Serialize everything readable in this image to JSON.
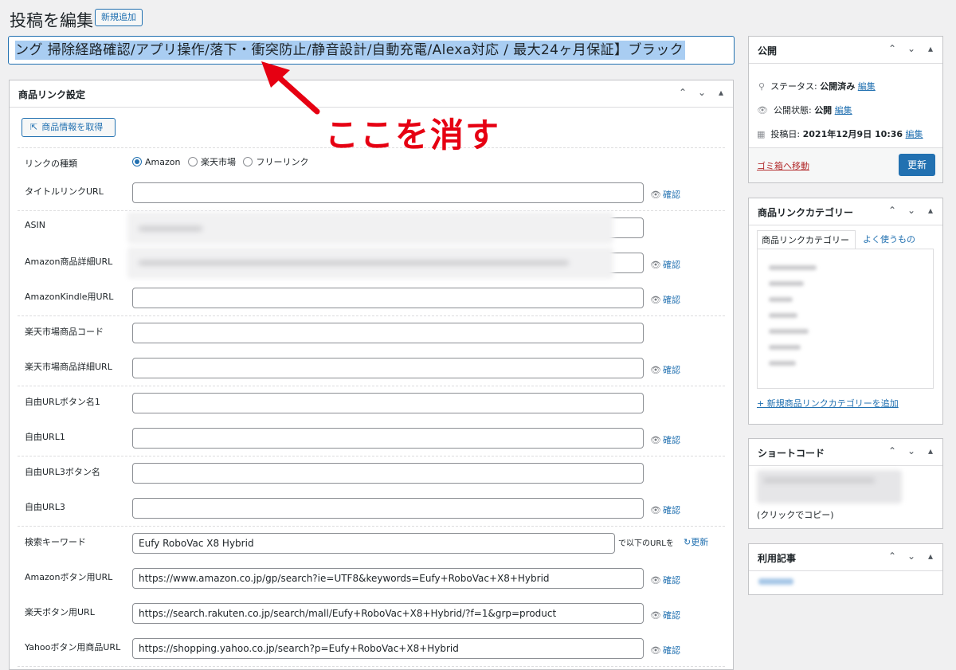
{
  "header": {
    "title": "投稿を編集",
    "add_new": "新規追加"
  },
  "post_title": "ング 掃除経路確認/アプリ操作/落下・衝突防止/静音設計/自動充電/Alexa対応 / 最大24ヶ月保証】ブラック",
  "annotation": {
    "text": "ここを消す",
    "color": "#e60012"
  },
  "metabox": {
    "title": "商品リンク設定",
    "get_info_button": "商品情報を取得",
    "link_type_label": "リンクの種類",
    "link_types": [
      "Amazon",
      "楽天市場",
      "フリーリンク"
    ],
    "check_label": "確認",
    "fields": {
      "title_url": {
        "label": "タイトルリンクURL",
        "value": ""
      },
      "asin": {
        "label": "ASIN"
      },
      "amazon_detail_url": {
        "label": "Amazon商品詳細URL"
      },
      "kindle_url": {
        "label": "AmazonKindle用URL",
        "value": ""
      },
      "rakuten_code": {
        "label": "楽天市場商品コード",
        "value": ""
      },
      "rakuten_detail_url": {
        "label": "楽天市場商品詳細URL",
        "value": ""
      },
      "free_btn1": {
        "label": "自由URLボタン名1",
        "value": ""
      },
      "free_url1": {
        "label": "自由URL1",
        "value": ""
      },
      "free_btn3": {
        "label": "自由URL3ボタン名",
        "value": ""
      },
      "free_url3": {
        "label": "自由URL3",
        "value": ""
      },
      "keyword": {
        "label": "検索キーワード",
        "value": "Eufy RoboVac X8 Hybrid",
        "suffix": "で以下のURLを",
        "refresh": "更新"
      },
      "amazon_btn_url": {
        "label": "Amazonボタン用URL",
        "value": "https://www.amazon.co.jp/gp/search?ie=UTF8&keywords=Eufy+RoboVac+X8+Hybrid"
      },
      "rakuten_btn_url": {
        "label": "楽天ボタン用URL",
        "value": "https://search.rakuten.co.jp/search/mall/Eufy+RoboVac+X8+Hybrid/?f=1&grp=product"
      },
      "yahoo_btn_url": {
        "label": "Yahooボタン用商品URL",
        "value": "https://shopping.yahoo.co.jp/search?p=Eufy+RoboVac+X8+Hybrid"
      }
    }
  },
  "publish": {
    "title": "公開",
    "status_label": "ステータス:",
    "status_value": "公開済み",
    "visibility_label": "公開状態:",
    "visibility_value": "公開",
    "date_label": "投稿日:",
    "date_value": "2021年12月9日 10:36",
    "edit": "編集",
    "trash": "ゴミ箱へ移動",
    "update": "更新"
  },
  "category_box": {
    "title": "商品リンクカテゴリー",
    "tab_all": "商品リンクカテゴリー",
    "tab_popular": "よく使うもの",
    "add_link": "+ 新規商品リンクカテゴリーを追加"
  },
  "shortcode_box": {
    "title": "ショートコード",
    "hint": "(クリックでコピー)"
  },
  "usage_box": {
    "title": "利用記事"
  }
}
